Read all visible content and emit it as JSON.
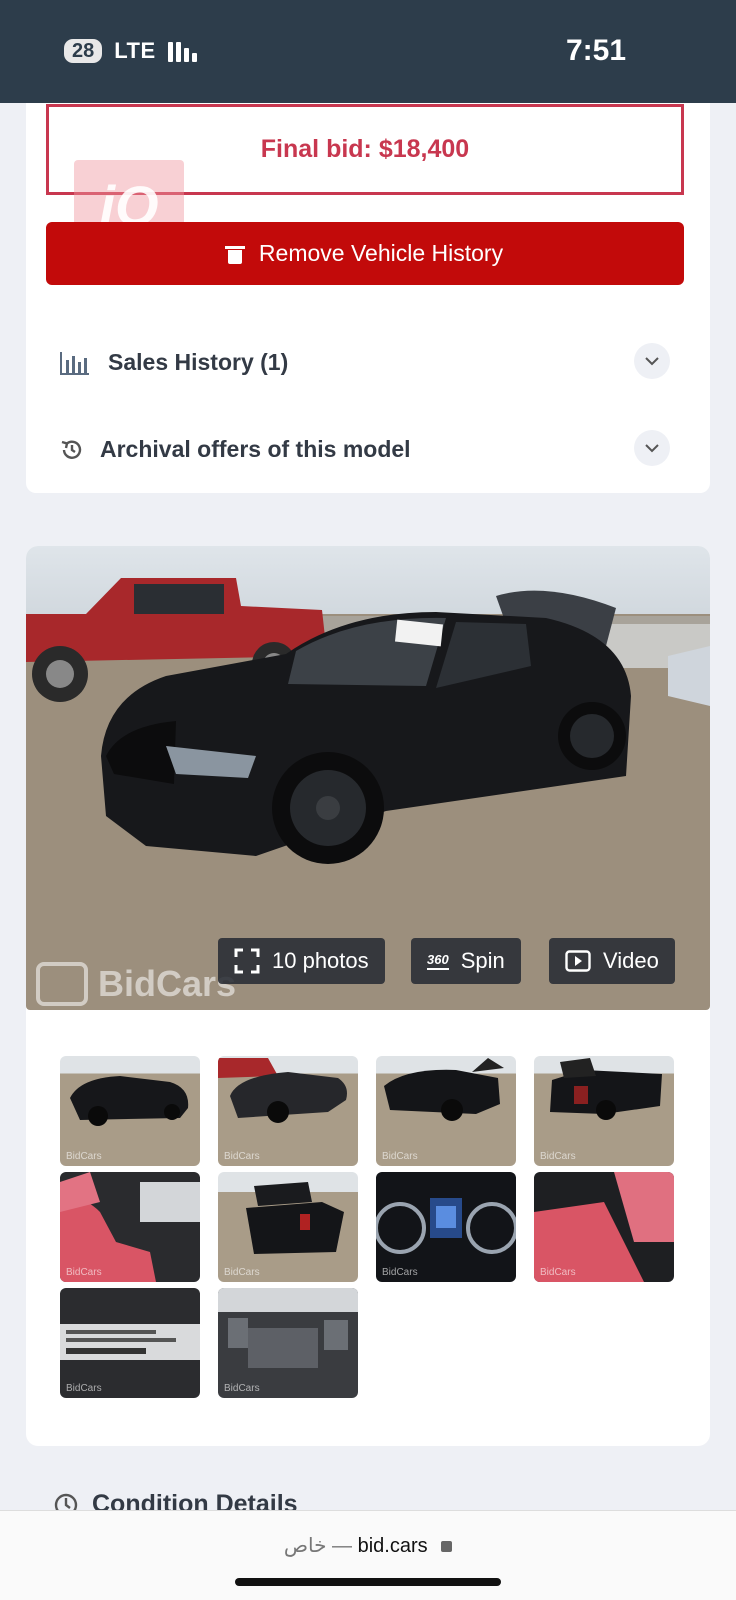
{
  "status_bar": {
    "battery": "28",
    "network": "LTE",
    "time": "7:51"
  },
  "bid": {
    "final_bid": "Final bid: $18,400"
  },
  "overlay_logo": "iQ",
  "remove_button": {
    "label": "Remove Vehicle History",
    "icon": "trash-icon"
  },
  "accordion": [
    {
      "label": "Sales History (1)",
      "icon": "bar-chart-icon"
    },
    {
      "label": "Archival offers of this model",
      "icon": "history-icon"
    }
  ],
  "gallery": {
    "watermark": "BidCars",
    "buttons": [
      {
        "label": "10 photos",
        "icon": "fullscreen-icon"
      },
      {
        "label": "Spin",
        "icon": "360-spin-icon",
        "icon_text": "360"
      },
      {
        "label": "Video",
        "icon": "play-icon"
      }
    ],
    "thumbnail_count": 10,
    "thumbnail_watermark": "BidCars"
  },
  "section": {
    "condition_title": "Condition Details"
  },
  "browser": {
    "private_label": "خاص",
    "separator": "—",
    "domain": "bid.cars"
  },
  "colors": {
    "accent_red": "#c20a0a",
    "bid_red": "#c8374f",
    "status_bar": "#2d3d4b"
  }
}
